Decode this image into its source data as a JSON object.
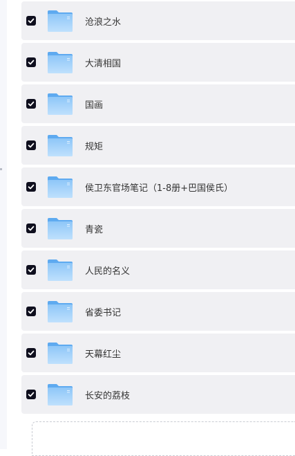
{
  "folders": [
    {
      "name": "沧浪之水",
      "checked": true
    },
    {
      "name": "大清相国",
      "checked": true
    },
    {
      "name": "国画",
      "checked": true
    },
    {
      "name": "规矩",
      "checked": true
    },
    {
      "name": "侯卫东官场笔记（1-8册+巴国侯氏）",
      "checked": true
    },
    {
      "name": "青瓷",
      "checked": true
    },
    {
      "name": "人民的名义",
      "checked": true
    },
    {
      "name": "省委书记",
      "checked": true
    },
    {
      "name": "天幕红尘",
      "checked": true
    },
    {
      "name": "长安的荔枝",
      "checked": true
    }
  ],
  "icons": {
    "checkbox": "check-icon",
    "folder": "folder-icon"
  },
  "colors": {
    "row_bg": "#f0f0f3",
    "checkbox_bg": "#0f0f1e",
    "folder_light": "#a9d3fb",
    "folder_dark": "#5eaaf0",
    "text": "#333333"
  }
}
